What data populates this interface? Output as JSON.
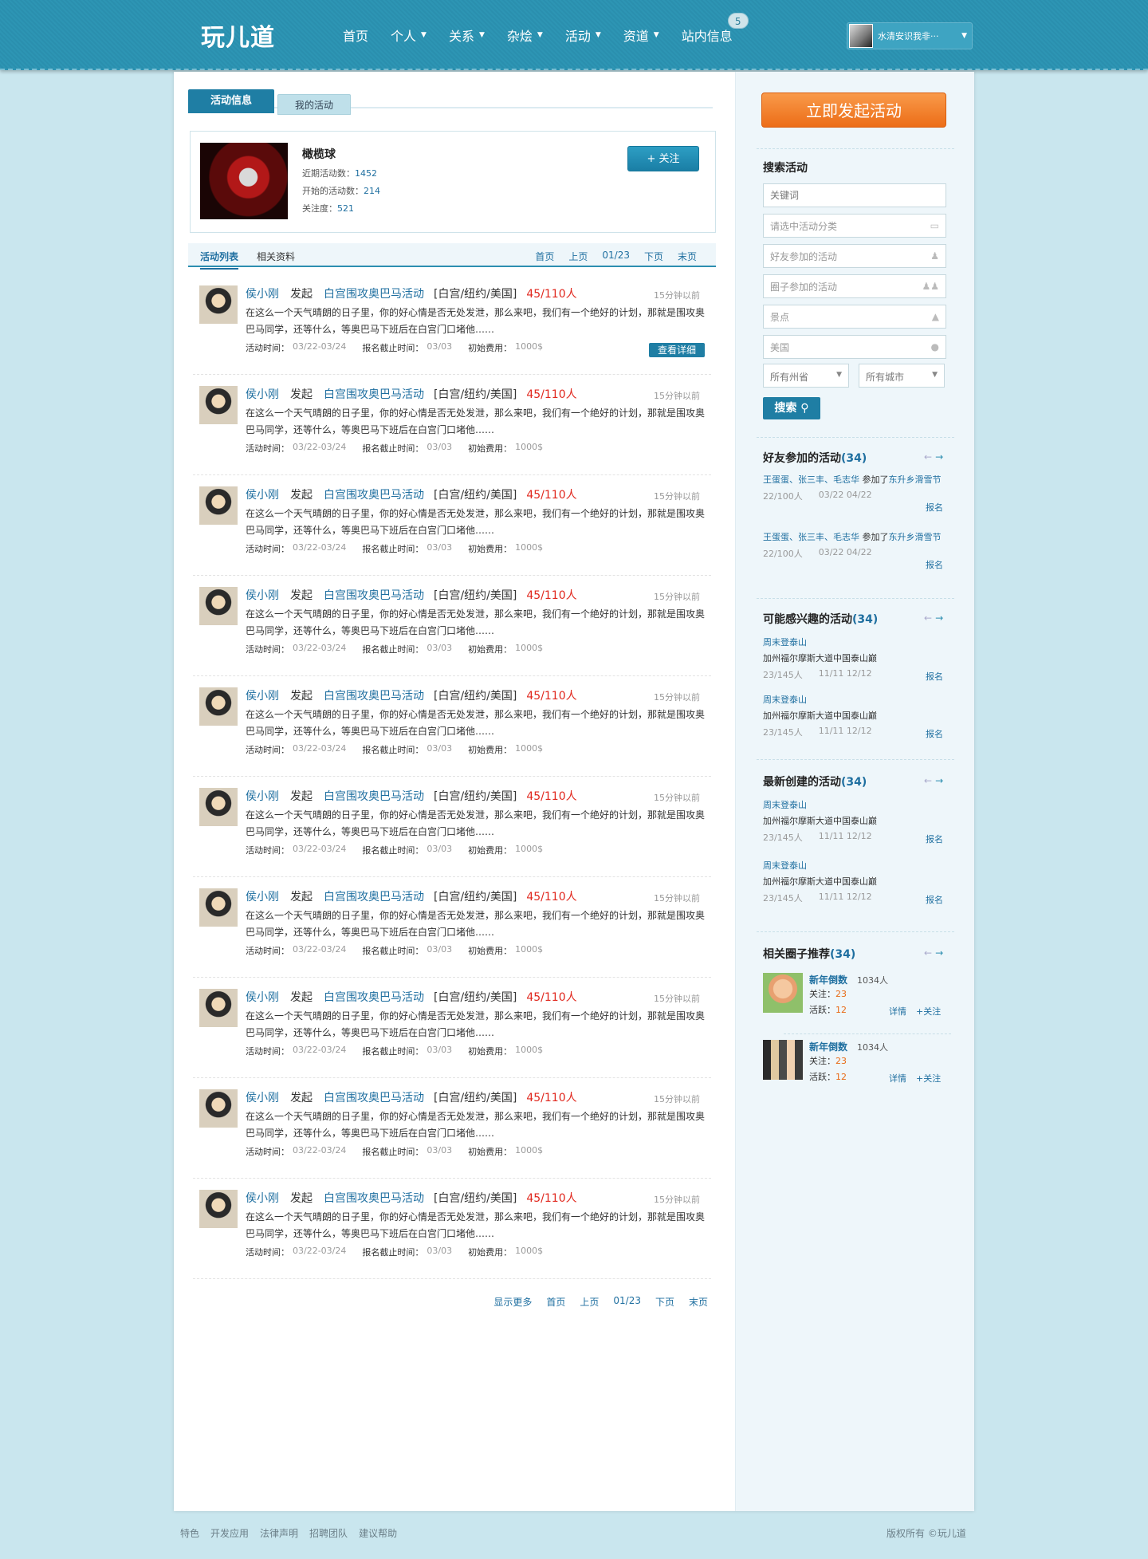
{
  "header": {
    "logo": "玩儿道",
    "nav": [
      {
        "label": "首页",
        "caret": false
      },
      {
        "label": "个人",
        "caret": true
      },
      {
        "label": "关系",
        "caret": true
      },
      {
        "label": "杂烩",
        "caret": true
      },
      {
        "label": "活动",
        "caret": true
      },
      {
        "label": "资道",
        "caret": true
      },
      {
        "label": "站内信息",
        "caret": false
      }
    ],
    "message_badge": "5",
    "user_name": "水清安识我非···"
  },
  "tabs": {
    "active": "活动信息",
    "inactive": "我的活动"
  },
  "sport": {
    "name": "橄榄球",
    "recent_label": "近期活动数：",
    "recent_value": "1452",
    "started_label": "开始的活动数：",
    "started_value": "214",
    "attention_label": "关注度：",
    "attention_value": "521",
    "follow_btn": "+ 关注"
  },
  "subnav": {
    "active": "活动列表",
    "other": "相关资料",
    "pager": [
      "首页",
      "上页",
      "01/23",
      "下页",
      "末页"
    ]
  },
  "activities": [
    {
      "poster": "侯小刚",
      "verb": "发起",
      "title": "白宫围攻奥巴马活动",
      "loc": "[白宫/纽约/美国]",
      "count": "45/110人",
      "time": "15分钟以前",
      "desc": "在这么一个天气晴朗的日子里，你的好心情是否无处发泄，那么来吧，我们有一个绝好的计划，那就是围攻奥巴马同学，还等什么，等奥巴马下班后在白宫门口堵他……",
      "time_label": "活动时间：",
      "time_value": "03/22-03/24",
      "deadline_label": "报名截止时间：",
      "deadline_value": "03/03",
      "fee_label": "初始费用：",
      "fee_value": "1000$",
      "detail": "查看详细"
    },
    {
      "poster": "侯小刚",
      "verb": "发起",
      "title": "白宫围攻奥巴马活动",
      "loc": "[白宫/纽约/美国]",
      "count": "45/110人",
      "time": "15分钟以前",
      "desc": "在这么一个天气晴朗的日子里，你的好心情是否无处发泄，那么来吧，我们有一个绝好的计划，那就是围攻奥巴马同学，还等什么，等奥巴马下班后在白宫门口堵他……",
      "time_label": "活动时间：",
      "time_value": "03/22-03/24",
      "deadline_label": "报名截止时间：",
      "deadline_value": "03/03",
      "fee_label": "初始费用：",
      "fee_value": "1000$",
      "detail": ""
    },
    {
      "poster": "侯小刚",
      "verb": "发起",
      "title": "白宫围攻奥巴马活动",
      "loc": "[白宫/纽约/美国]",
      "count": "45/110人",
      "time": "15分钟以前",
      "desc": "在这么一个天气晴朗的日子里，你的好心情是否无处发泄，那么来吧，我们有一个绝好的计划，那就是围攻奥巴马同学，还等什么，等奥巴马下班后在白宫门口堵他……",
      "time_label": "活动时间：",
      "time_value": "03/22-03/24",
      "deadline_label": "报名截止时间：",
      "deadline_value": "03/03",
      "fee_label": "初始费用：",
      "fee_value": "1000$",
      "detail": ""
    },
    {
      "poster": "侯小刚",
      "verb": "发起",
      "title": "白宫围攻奥巴马活动",
      "loc": "[白宫/纽约/美国]",
      "count": "45/110人",
      "time": "15分钟以前",
      "desc": "在这么一个天气晴朗的日子里，你的好心情是否无处发泄，那么来吧，我们有一个绝好的计划，那就是围攻奥巴马同学，还等什么，等奥巴马下班后在白宫门口堵他……",
      "time_label": "活动时间：",
      "time_value": "03/22-03/24",
      "deadline_label": "报名截止时间：",
      "deadline_value": "03/03",
      "fee_label": "初始费用：",
      "fee_value": "1000$",
      "detail": ""
    },
    {
      "poster": "侯小刚",
      "verb": "发起",
      "title": "白宫围攻奥巴马活动",
      "loc": "[白宫/纽约/美国]",
      "count": "45/110人",
      "time": "15分钟以前",
      "desc": "在这么一个天气晴朗的日子里，你的好心情是否无处发泄，那么来吧，我们有一个绝好的计划，那就是围攻奥巴马同学，还等什么，等奥巴马下班后在白宫门口堵他……",
      "time_label": "活动时间：",
      "time_value": "03/22-03/24",
      "deadline_label": "报名截止时间：",
      "deadline_value": "03/03",
      "fee_label": "初始费用：",
      "fee_value": "1000$",
      "detail": ""
    },
    {
      "poster": "侯小刚",
      "verb": "发起",
      "title": "白宫围攻奥巴马活动",
      "loc": "[白宫/纽约/美国]",
      "count": "45/110人",
      "time": "15分钟以前",
      "desc": "在这么一个天气晴朗的日子里，你的好心情是否无处发泄，那么来吧，我们有一个绝好的计划，那就是围攻奥巴马同学，还等什么，等奥巴马下班后在白宫门口堵他……",
      "time_label": "活动时间：",
      "time_value": "03/22-03/24",
      "deadline_label": "报名截止时间：",
      "deadline_value": "03/03",
      "fee_label": "初始费用：",
      "fee_value": "1000$",
      "detail": ""
    },
    {
      "poster": "侯小刚",
      "verb": "发起",
      "title": "白宫围攻奥巴马活动",
      "loc": "[白宫/纽约/美国]",
      "count": "45/110人",
      "time": "15分钟以前",
      "desc": "在这么一个天气晴朗的日子里，你的好心情是否无处发泄，那么来吧，我们有一个绝好的计划，那就是围攻奥巴马同学，还等什么，等奥巴马下班后在白宫门口堵他……",
      "time_label": "活动时间：",
      "time_value": "03/22-03/24",
      "deadline_label": "报名截止时间：",
      "deadline_value": "03/03",
      "fee_label": "初始费用：",
      "fee_value": "1000$",
      "detail": ""
    },
    {
      "poster": "侯小刚",
      "verb": "发起",
      "title": "白宫围攻奥巴马活动",
      "loc": "[白宫/纽约/美国]",
      "count": "45/110人",
      "time": "15分钟以前",
      "desc": "在这么一个天气晴朗的日子里，你的好心情是否无处发泄，那么来吧，我们有一个绝好的计划，那就是围攻奥巴马同学，还等什么，等奥巴马下班后在白宫门口堵他……",
      "time_label": "活动时间：",
      "time_value": "03/22-03/24",
      "deadline_label": "报名截止时间：",
      "deadline_value": "03/03",
      "fee_label": "初始费用：",
      "fee_value": "1000$",
      "detail": ""
    },
    {
      "poster": "侯小刚",
      "verb": "发起",
      "title": "白宫围攻奥巴马活动",
      "loc": "[白宫/纽约/美国]",
      "count": "45/110人",
      "time": "15分钟以前",
      "desc": "在这么一个天气晴朗的日子里，你的好心情是否无处发泄，那么来吧，我们有一个绝好的计划，那就是围攻奥巴马同学，还等什么，等奥巴马下班后在白宫门口堵他……",
      "time_label": "活动时间：",
      "time_value": "03/22-03/24",
      "deadline_label": "报名截止时间：",
      "deadline_value": "03/03",
      "fee_label": "初始费用：",
      "fee_value": "1000$",
      "detail": ""
    },
    {
      "poster": "侯小刚",
      "verb": "发起",
      "title": "白宫围攻奥巴马活动",
      "loc": "[白宫/纽约/美国]",
      "count": "45/110人",
      "time": "15分钟以前",
      "desc": "在这么一个天气晴朗的日子里，你的好心情是否无处发泄，那么来吧，我们有一个绝好的计划，那就是围攻奥巴马同学，还等什么，等奥巴马下班后在白宫门口堵他……",
      "time_label": "活动时间：",
      "time_value": "03/22-03/24",
      "deadline_label": "报名截止时间：",
      "deadline_value": "03/03",
      "fee_label": "初始费用：",
      "fee_value": "1000$",
      "detail": ""
    }
  ],
  "pager_bottom": [
    "显示更多",
    "首页",
    "上页",
    "01/23",
    "下页",
    "末页"
  ],
  "sidebar": {
    "launch_btn": "立即发起活动",
    "search_title": "搜索活动",
    "search_fields": [
      {
        "placeholder": "关键词",
        "icon": ""
      },
      {
        "placeholder": "请选中活动分类",
        "icon": "folder-icon"
      },
      {
        "placeholder": "好友参加的活动",
        "icon": "person-icon"
      },
      {
        "placeholder": "圈子参加的活动",
        "icon": "group-icon"
      },
      {
        "placeholder": "景点",
        "icon": "landscape-icon"
      },
      {
        "placeholder": "美国",
        "icon": "globe-icon"
      }
    ],
    "select_state": "所有州省",
    "select_city": "所有城市",
    "search_btn": "搜索",
    "friends_title": "好友参加的活动",
    "friends_count": "(34)",
    "friend_items": [
      {
        "names": "王蛋蛋、张三丰、毛志华",
        "joined": " 参加了",
        "dest": "东升乡滑雪节",
        "people": "22/100人",
        "dates": "03/22 04/22",
        "join": "报名"
      },
      {
        "names": "王蛋蛋、张三丰、毛志华",
        "joined": " 参加了",
        "dest": "东升乡滑雪节",
        "people": "22/100人",
        "dates": "03/22 04/22",
        "join": "报名"
      }
    ],
    "interest_title": "可能感兴趣的活动",
    "interest_count": "(34)",
    "interest_items": [
      {
        "t1": "周末登泰山",
        "t2": "加州福尔摩斯大道中国泰山巅",
        "people": "23/145人",
        "dates": "11/11 12/12",
        "join": "报名"
      },
      {
        "t1": "周末登泰山",
        "t2": "加州福尔摩斯大道中国泰山巅",
        "people": "23/145人",
        "dates": "11/11 12/12",
        "join": "报名"
      }
    ],
    "newest_title": "最新创建的活动",
    "newest_count": "(34)",
    "newest_items": [
      {
        "t1": "周末登泰山",
        "t2": "加州福尔摩斯大道中国泰山巅",
        "people": "23/145人",
        "dates": "11/11 12/12",
        "join": "报名"
      },
      {
        "t1": "周末登泰山",
        "t2": "加州福尔摩斯大道中国泰山巅",
        "people": "23/145人",
        "dates": "11/11 12/12",
        "join": "报名"
      }
    ],
    "groups_title": "相关圈子推荐",
    "groups_count": "(34)",
    "groups": [
      {
        "name": "新年倒数",
        "members": "1034人",
        "follow_label": "关注：",
        "follow_value": "23",
        "active_label": "活跃：",
        "active_value": "12",
        "detail": "详情",
        "follow": "+关注"
      },
      {
        "name": "新年倒数",
        "members": "1034人",
        "follow_label": "关注：",
        "follow_value": "23",
        "active_label": "活跃：",
        "active_value": "12",
        "detail": "详情",
        "follow": "+关注"
      }
    ]
  },
  "footer": {
    "links": [
      "特色",
      "开发应用",
      "法律声明",
      "招聘团队",
      "建议帮助"
    ],
    "copyright": "版权所有 ©玩儿道"
  },
  "colors": {
    "brand": "#2d95b4",
    "accent": "#1f7ea4",
    "orange": "#ec6d17",
    "red": "#e0261c"
  }
}
